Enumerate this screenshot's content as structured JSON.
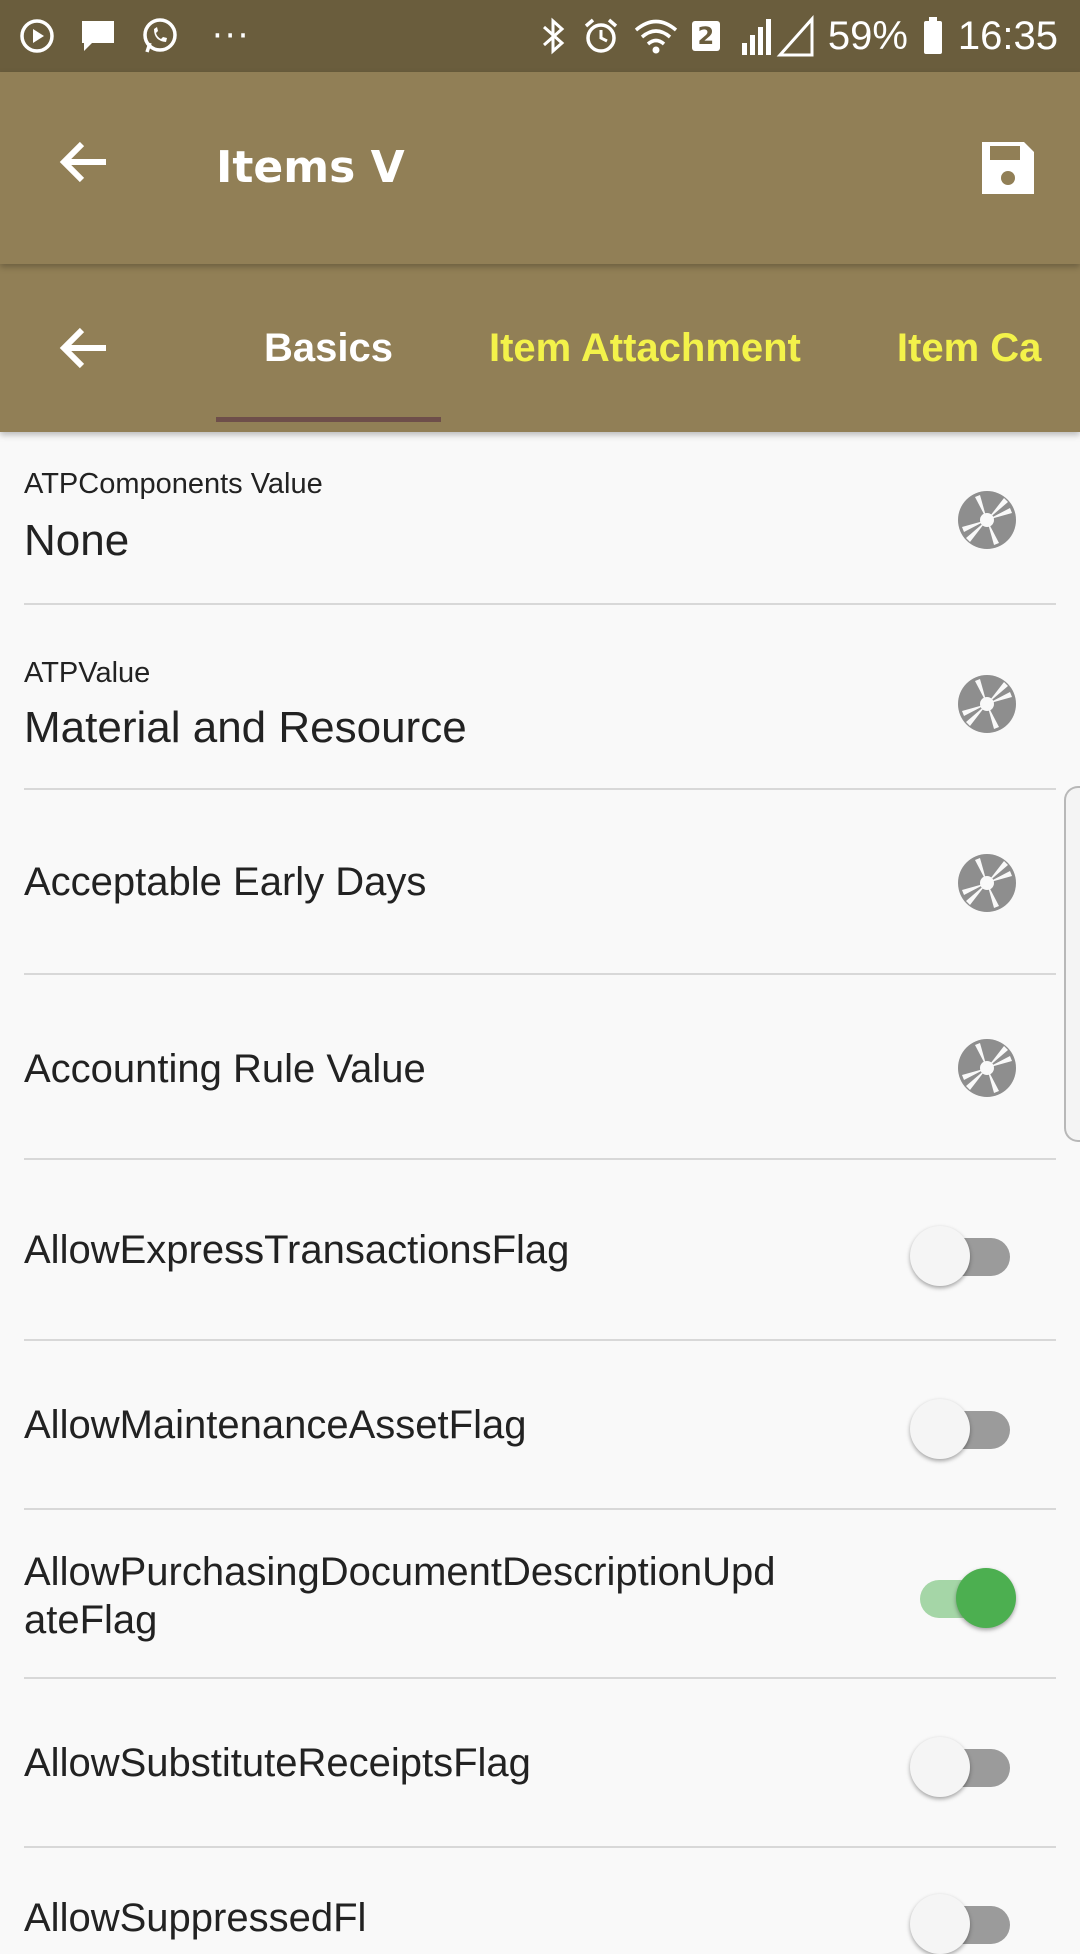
{
  "status_bar": {
    "battery": "59%",
    "time": "16:35",
    "sim_badge": "2",
    "more": "···",
    "icons_left": [
      "play-circle-icon",
      "message-icon",
      "whatsapp-icon"
    ],
    "icons_right": [
      "bluetooth-icon",
      "alarm-icon",
      "wifi-icon",
      "signal-icon",
      "battery-icon"
    ]
  },
  "app_bar": {
    "title": "Items V",
    "back_icon": "arrow-left-icon",
    "save_icon": "floppy-disk-icon"
  },
  "tabs": {
    "items": [
      {
        "label": "Basics",
        "active": true
      },
      {
        "label": "Item Attachment",
        "active": false
      },
      {
        "label": "Item Ca",
        "active": false
      }
    ],
    "active_color": "#ffffff",
    "inactive_color": "#f3f24a",
    "indicator_color": "#6e4e4a"
  },
  "colors": {
    "status_bar": "#6a5d3d",
    "app_bar": "#917f56",
    "toggle_on": "#4caf50",
    "toggle_off_track": "#9b9b9b"
  },
  "fields": [
    {
      "caption": "ATPComponents Value",
      "value": "None",
      "control": "aperture-icon"
    },
    {
      "caption": "ATPValue",
      "value": "Material and Resource",
      "control": "aperture-icon"
    },
    {
      "label": "Acceptable Early Days",
      "control": "aperture-icon"
    },
    {
      "label": "Accounting Rule Value",
      "control": "aperture-icon"
    },
    {
      "label": "AllowExpressTransactionsFlag",
      "toggle": false
    },
    {
      "label": "AllowMaintenanceAssetFlag",
      "toggle": false
    },
    {
      "label_line1": "AllowPurchasingDocumentDescriptionUpd",
      "label_line2": "ateFlag",
      "toggle": true
    },
    {
      "label": "AllowSubstituteReceiptsFlag",
      "toggle": false
    },
    {
      "label": "AllowSuppressedFl",
      "toggle": false
    }
  ]
}
